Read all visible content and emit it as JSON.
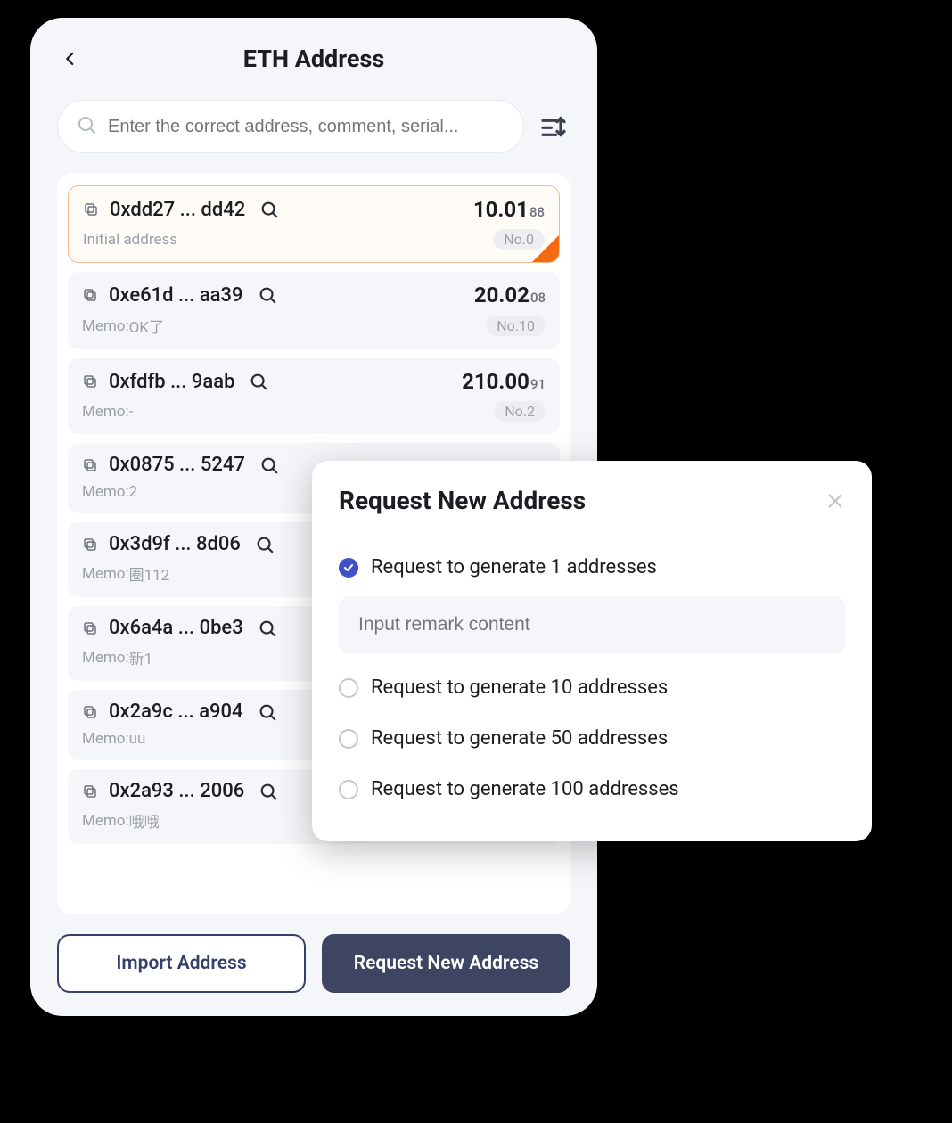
{
  "header": {
    "title": "ETH Address"
  },
  "search": {
    "placeholder": "Enter the correct address, comment, serial..."
  },
  "addresses": [
    {
      "addr": "0xdd27 ... dd42",
      "bal_main": "10.01",
      "bal_sub": "88",
      "memo_label": "Initial address",
      "memo_value": "",
      "no": "No.0",
      "selected": true
    },
    {
      "addr": "0xe61d ... aa39",
      "bal_main": "20.02",
      "bal_sub": "08",
      "memo_label": "Memo: ",
      "memo_value": "OK了",
      "no": "No.10",
      "selected": false
    },
    {
      "addr": "0xfdfb ... 9aab",
      "bal_main": "210.00",
      "bal_sub": "91",
      "memo_label": "Memo: ",
      "memo_value": "-",
      "no": "No.2",
      "selected": false
    },
    {
      "addr": "0x0875 ... 5247",
      "bal_main": "",
      "bal_sub": "",
      "memo_label": "Memo: ",
      "memo_value": "2",
      "no": "",
      "selected": false
    },
    {
      "addr": "0x3d9f ... 8d06",
      "bal_main": "",
      "bal_sub": "",
      "memo_label": "Memo: ",
      "memo_value": "圈112",
      "no": "",
      "selected": false
    },
    {
      "addr": "0x6a4a ... 0be3",
      "bal_main": "",
      "bal_sub": "",
      "memo_label": "Memo: ",
      "memo_value": "新1",
      "no": "",
      "selected": false
    },
    {
      "addr": "0x2a9c ... a904",
      "bal_main": "",
      "bal_sub": "",
      "memo_label": "Memo: ",
      "memo_value": "uu",
      "no": "",
      "selected": false
    },
    {
      "addr": "0x2a93 ... 2006",
      "bal_main": "",
      "bal_sub": "",
      "memo_label": "Memo: ",
      "memo_value": "哦哦",
      "no": "",
      "selected": false
    }
  ],
  "buttons": {
    "import": "Import Address",
    "request": "Request New Address"
  },
  "modal": {
    "title": "Request New Address",
    "options": [
      {
        "label": "Request to generate 1 addresses",
        "checked": true
      },
      {
        "label": "Request to generate 10 addresses",
        "checked": false
      },
      {
        "label": "Request to generate 50 addresses",
        "checked": false
      },
      {
        "label": "Request to generate 100 addresses",
        "checked": false
      }
    ],
    "remark_placeholder": "Input remark content"
  }
}
